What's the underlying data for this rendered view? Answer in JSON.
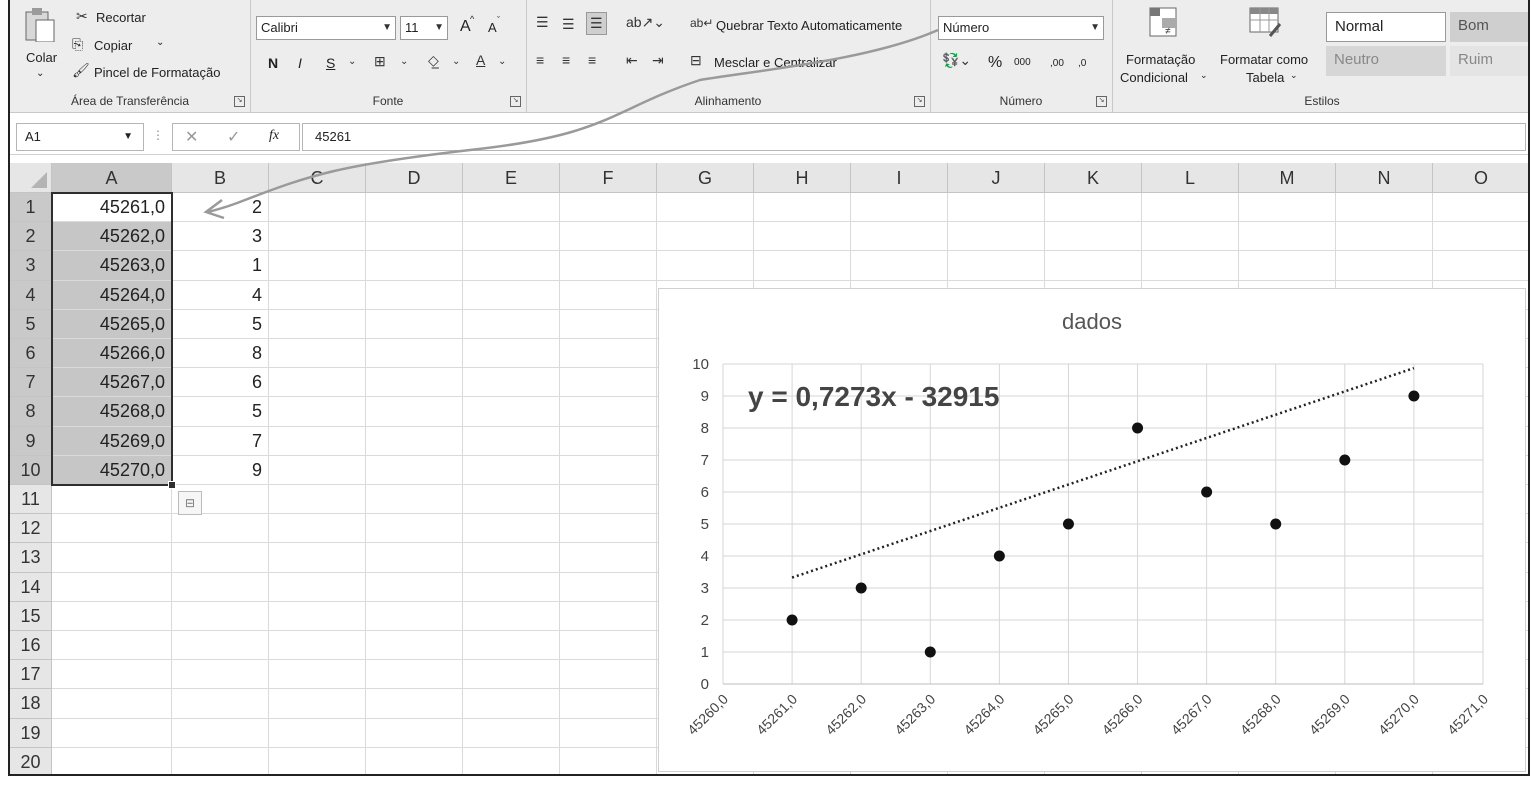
{
  "ribbon": {
    "clipboard": {
      "paste_label": "Colar",
      "cut_label": "Recortar",
      "copy_label": "Copiar",
      "format_painter_label": "Pincel de Formatação",
      "group_label": "Área de Transferência"
    },
    "font": {
      "font_name": "Calibri",
      "font_size": "11",
      "grow_label": "A",
      "shrink_label": "A",
      "bold_label": "N",
      "italic_label": "I",
      "underline_label": "S",
      "group_label": "Fonte"
    },
    "alignment": {
      "wrap_text_label": "Quebrar Texto Automaticamente",
      "merge_center_label": "Mesclar e Centralizar",
      "group_label": "Alinhamento"
    },
    "number": {
      "format_value": "Número",
      "percent_label": "%",
      "thousands_label": "000",
      "increase_decimal_label": ",00",
      "decrease_decimal_label": ",0",
      "group_label": "Número"
    },
    "styles": {
      "conditional_label_1": "Formatação",
      "conditional_label_2": "Condicional",
      "table_label_1": "Formatar como",
      "table_label_2": "Tabela",
      "normal_label": "Normal",
      "good_label": "Bom",
      "neutral_label": "Neutro",
      "bad_label": "Ruim",
      "group_label": "Estilos"
    }
  },
  "formula_bar": {
    "name_box": "A1",
    "fx_label": "fx",
    "value": "45261"
  },
  "sheet": {
    "columns": [
      "A",
      "B",
      "C",
      "D",
      "E",
      "F",
      "G",
      "H",
      "I",
      "J",
      "K",
      "L",
      "M",
      "N",
      "O"
    ],
    "rows": [
      "1",
      "2",
      "3",
      "4",
      "5",
      "6",
      "7",
      "8",
      "9",
      "10",
      "11",
      "12",
      "13",
      "14",
      "15",
      "16",
      "17",
      "18",
      "19",
      "20"
    ],
    "col_a": [
      "45261,0",
      "45262,0",
      "45263,0",
      "45264,0",
      "45265,0",
      "45266,0",
      "45267,0",
      "45268,0",
      "45269,0",
      "45270,0"
    ],
    "col_b": [
      "2",
      "3",
      "1",
      "4",
      "5",
      "8",
      "6",
      "5",
      "7",
      "9"
    ]
  },
  "chart_data": {
    "type": "scatter",
    "title": "dados",
    "trendline_equation": "y = 0,7273x - 32915",
    "trendline": {
      "type": "linear",
      "slope": 0.7273,
      "intercept": -32915
    },
    "x": [
      45261,
      45262,
      45263,
      45264,
      45265,
      45266,
      45267,
      45268,
      45269,
      45270
    ],
    "y": [
      2,
      3,
      1,
      4,
      5,
      8,
      6,
      5,
      7,
      9
    ],
    "xlim": [
      45260,
      45271
    ],
    "ylim": [
      0,
      10
    ],
    "x_ticks": [
      "45260,0",
      "45261,0",
      "45262,0",
      "45263,0",
      "45264,0",
      "45265,0",
      "45266,0",
      "45267,0",
      "45268,0",
      "45269,0",
      "45270,0",
      "45271,0"
    ],
    "y_ticks": [
      "0",
      "1",
      "2",
      "3",
      "4",
      "5",
      "6",
      "7",
      "8",
      "9",
      "10"
    ],
    "grid": true,
    "marker_color": "#111111",
    "trendline_color": "#222222"
  },
  "colors": {
    "ribbon_bg": "#ededed",
    "selection_fill": "#c6c6c6",
    "annotation_arrow": "#999999"
  }
}
